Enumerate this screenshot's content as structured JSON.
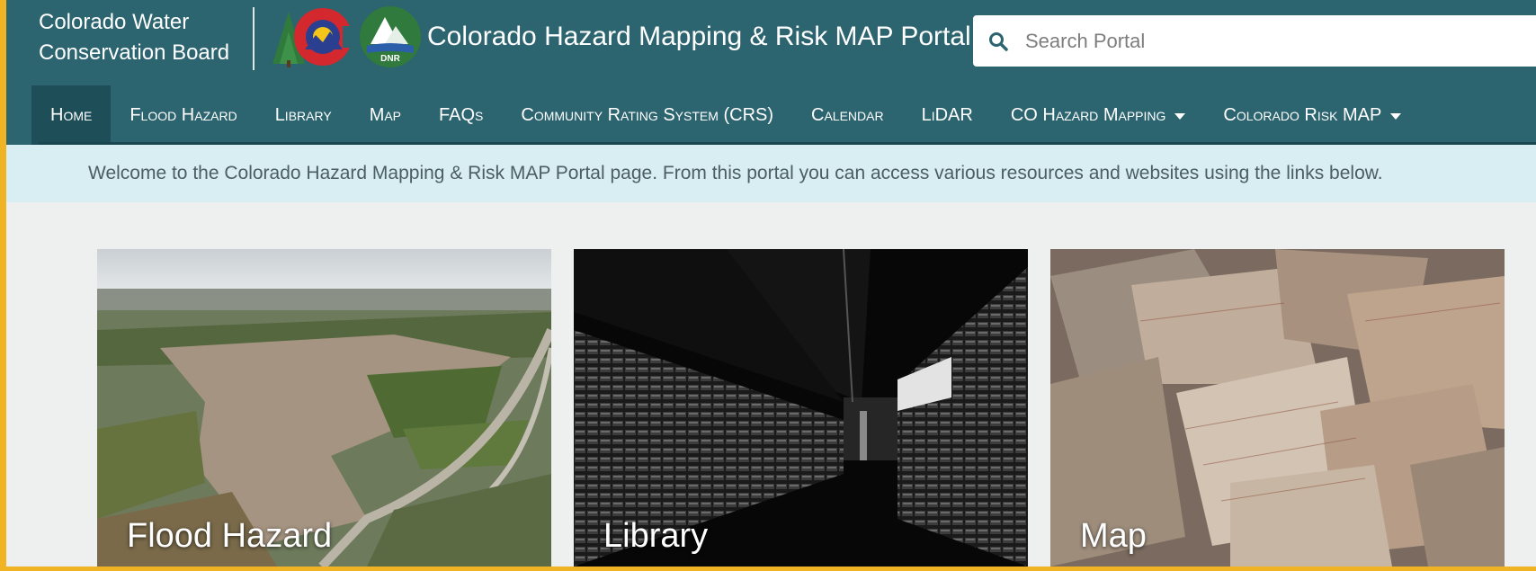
{
  "header": {
    "org_name_line1": "Colorado Water",
    "org_name_line2": "Conservation Board",
    "dnr_logo_text": "DNR",
    "portal_title": "Colorado Hazard Mapping & Risk MAP Portal",
    "search": {
      "placeholder": "Search Portal"
    }
  },
  "nav": {
    "items": [
      {
        "label": "Home",
        "active": true
      },
      {
        "label": "Flood Hazard"
      },
      {
        "label": "Library"
      },
      {
        "label": "Map"
      },
      {
        "label": "FAQs"
      },
      {
        "label": "Community Rating System (CRS)"
      },
      {
        "label": "Calendar"
      },
      {
        "label": "LiDAR"
      },
      {
        "label": "CO Hazard Mapping",
        "dropdown": true
      },
      {
        "label": "Colorado Risk MAP",
        "dropdown": true
      }
    ]
  },
  "welcome": {
    "text": "Welcome to the Colorado Hazard Mapping & Risk MAP Portal page. From this portal you can access various resources and websites using the links below."
  },
  "cards": [
    {
      "label": "Flood Hazard"
    },
    {
      "label": "Library"
    },
    {
      "label": "Map"
    }
  ],
  "colors": {
    "header_bg": "#2c6470",
    "nav_active_bg": "#1e4e58",
    "welcome_bg": "#d8eef2",
    "page_bg": "#eef0f0",
    "frame_accent": "#f0b323"
  }
}
